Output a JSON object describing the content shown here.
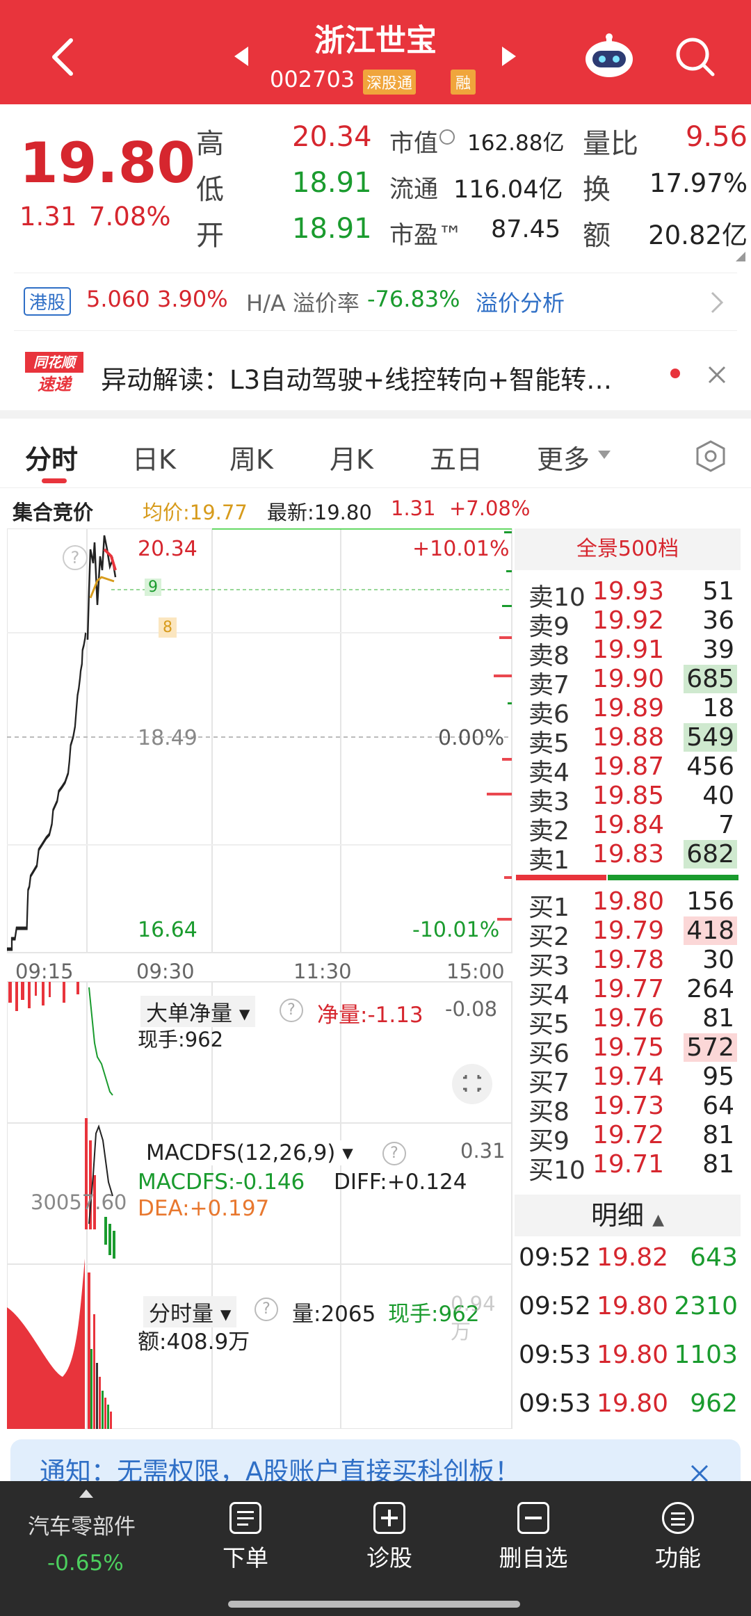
{
  "header": {
    "title": "浙江世宝",
    "code": "002703",
    "badge1": "深股通",
    "badge2": "融"
  },
  "quote": {
    "price": "19.80",
    "change": "1.31",
    "change_pct": "7.08%",
    "high_label": "高",
    "high": "20.34",
    "low_label": "低",
    "low": "18.91",
    "open_label": "开",
    "open": "18.91",
    "mcap_label": "市值",
    "mcap": "162.88亿",
    "float_label": "流通",
    "float": "116.04亿",
    "pe_label": "市盈™",
    "pe": "87.45",
    "vr_label": "量比",
    "vr": "9.56",
    "turnover_label": "换",
    "turnover": "17.97%",
    "amount_label": "额",
    "amount": "20.82亿"
  },
  "hk": {
    "tag": "港股",
    "price": "5.060",
    "pct": "3.90%",
    "premium_label": "H/A 溢价率",
    "premium": "-76.83%",
    "link": "溢价分析"
  },
  "news": {
    "logo_top": "同花顺",
    "logo_bottom": "速递",
    "text": "异动解读：L3自动驾驶+线控转向+智能转…"
  },
  "tabs": [
    "分时",
    "日K",
    "周K",
    "月K",
    "五日",
    "更多"
  ],
  "info": {
    "auction": "集合竞价",
    "avg": "均价:19.77",
    "last": "最新:19.80",
    "chg": "1.31",
    "pct": "+7.08%"
  },
  "chart_labels": {
    "top_price": "20.34",
    "mid_price": "18.49",
    "bottom_price": "16.64",
    "top_pct": "+10.01%",
    "mid_pct": "0.00%",
    "bottom_pct": "-10.01%",
    "t1": "09:15",
    "t2": "09:30",
    "t3": "11:30",
    "t4": "15:00",
    "marker9": "9",
    "marker8": "8"
  },
  "panel1": {
    "title": "大单净量",
    "net": "净量:-1.13",
    "right": "-0.08",
    "now": "现手:962"
  },
  "panel2": {
    "title": "MACDFS(12,26,9)",
    "right": "0.31",
    "macd": "MACDFS:-0.146",
    "diff": "DIFF:+0.124",
    "dea": "DEA:+0.197",
    "left": "30057.60"
  },
  "panel3": {
    "title": "分时量",
    "vol": "量:2065",
    "now": "现手:962",
    "right": "0.94万",
    "amt": "额:408.9万"
  },
  "book": {
    "header": "全景500档",
    "asks": [
      {
        "l": "卖10",
        "p": "19.93",
        "v": "51",
        "h": false
      },
      {
        "l": "卖9",
        "p": "19.92",
        "v": "36",
        "h": false
      },
      {
        "l": "卖8",
        "p": "19.91",
        "v": "39",
        "h": false
      },
      {
        "l": "卖7",
        "p": "19.90",
        "v": "685",
        "h": true
      },
      {
        "l": "卖6",
        "p": "19.89",
        "v": "18",
        "h": false
      },
      {
        "l": "卖5",
        "p": "19.88",
        "v": "549",
        "h": true
      },
      {
        "l": "卖4",
        "p": "19.87",
        "v": "456",
        "h": false
      },
      {
        "l": "卖3",
        "p": "19.85",
        "v": "40",
        "h": false
      },
      {
        "l": "卖2",
        "p": "19.84",
        "v": "7",
        "h": false
      },
      {
        "l": "卖1",
        "p": "19.83",
        "v": "682",
        "h": true
      }
    ],
    "bids": [
      {
        "l": "买1",
        "p": "19.80",
        "v": "156",
        "h": false
      },
      {
        "l": "买2",
        "p": "19.79",
        "v": "418",
        "h": true
      },
      {
        "l": "买3",
        "p": "19.78",
        "v": "30",
        "h": false
      },
      {
        "l": "买4",
        "p": "19.77",
        "v": "264",
        "h": false
      },
      {
        "l": "买5",
        "p": "19.76",
        "v": "81",
        "h": false
      },
      {
        "l": "买6",
        "p": "19.75",
        "v": "572",
        "h": true
      },
      {
        "l": "买7",
        "p": "19.74",
        "v": "95",
        "h": false
      },
      {
        "l": "买8",
        "p": "19.73",
        "v": "64",
        "h": false
      },
      {
        "l": "买9",
        "p": "19.72",
        "v": "81",
        "h": false
      },
      {
        "l": "买10",
        "p": "19.71",
        "v": "81",
        "h": false
      }
    ],
    "detail_title": "明细",
    "details": [
      {
        "t": "09:52",
        "p": "19.82",
        "v": "643"
      },
      {
        "t": "09:52",
        "p": "19.80",
        "v": "2310"
      },
      {
        "t": "09:53",
        "p": "19.80",
        "v": "1103"
      },
      {
        "t": "09:53",
        "p": "19.80",
        "v": "962"
      }
    ]
  },
  "notice": {
    "text": "通知：无需权限，A股账户直接买科创板！"
  },
  "bottom": {
    "sector": "汽车零部件",
    "sector_pct": "-0.65%",
    "items": [
      "下单",
      "诊股",
      "删自选",
      "功能"
    ]
  },
  "colors": {
    "red": "#e8343c",
    "green": "#1a9b2e"
  }
}
